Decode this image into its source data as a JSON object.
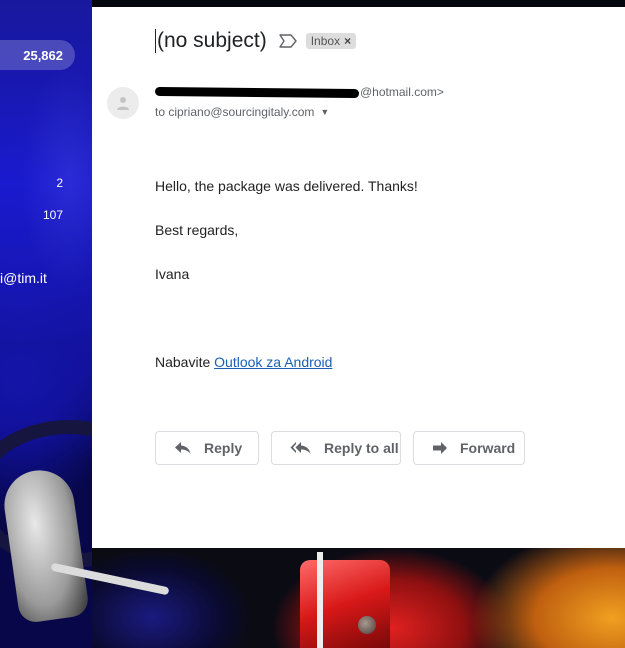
{
  "sidebar": {
    "inbox_count": "25,862",
    "count_a": "2",
    "count_b": "107",
    "email_fragment": "i@tim.it"
  },
  "email": {
    "subject": "(no subject)",
    "label_chip": "Inbox",
    "label_remove": "×",
    "sender_suffix": "@hotmail.com>",
    "recipient": "to cipriano@sourcingitaly.com",
    "body": {
      "greeting": "Hello, the package was delivered. Thanks!",
      "closing": "Best regards,",
      "signature": "Ivana",
      "footer_prefix": "Nabavite ",
      "footer_link": "Outlook za Android"
    }
  },
  "actions": {
    "reply": "Reply",
    "reply_all": "Reply to all",
    "forward": "Forward"
  },
  "colors": {
    "link": "#1a5fb4",
    "button_text": "#5f6368",
    "chip_bg": "#dddddd"
  },
  "icons": {
    "important": "important-marker-icon",
    "avatar": "person-avatar-icon",
    "reply": "reply-arrow-icon",
    "reply_all": "reply-all-arrow-icon",
    "forward": "forward-arrow-icon"
  }
}
